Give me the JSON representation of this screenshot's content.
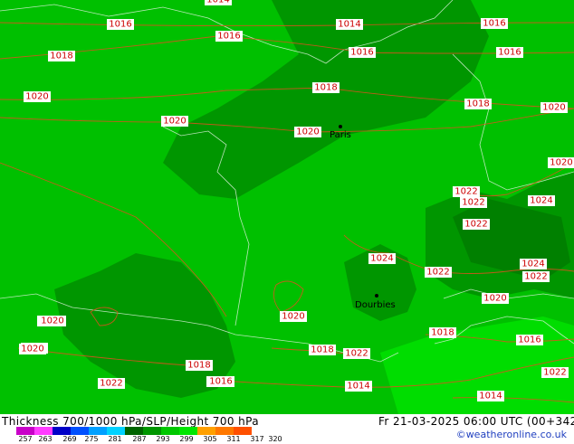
{
  "title": "Thickness 700/1000 hPa/SLP/Height 700 hPa",
  "valid_time": "Fr 21-03-2025 06:00 UTC (00+342)",
  "credit": "©weatheronline.co.uk",
  "legend": {
    "ticks": [
      "257",
      "263",
      "269",
      "275",
      "281",
      "287",
      "293",
      "299",
      "305",
      "311",
      "317",
      "320"
    ],
    "colors": [
      "#c800c8",
      "#ff3cff",
      "#0000c8",
      "#0050ff",
      "#00a0ff",
      "#00d2ff",
      "#006400",
      "#009600",
      "#00c800",
      "#00e600",
      "#ffa000",
      "#ff7800",
      "#ff5000"
    ]
  },
  "cities": [
    {
      "name": "Paris"
    },
    {
      "name": "Dourbies"
    }
  ],
  "isobar_labels": [
    "1014",
    "1016",
    "1016",
    "1014",
    "1016",
    "1016",
    "1018",
    "1016",
    "1018",
    "1020",
    "1018",
    "1020",
    "1020",
    "1020",
    "1020",
    "1022",
    "1022",
    "1022",
    "1024",
    "1024",
    "1022",
    "1024",
    "1022",
    "1022",
    "1020",
    "1024",
    "1022",
    "1020",
    "1018",
    "1018",
    "1020",
    "1016",
    "1016",
    "1014",
    "1018",
    "1022",
    "1022",
    "1020",
    "1020",
    "1016",
    "1014"
  ]
}
